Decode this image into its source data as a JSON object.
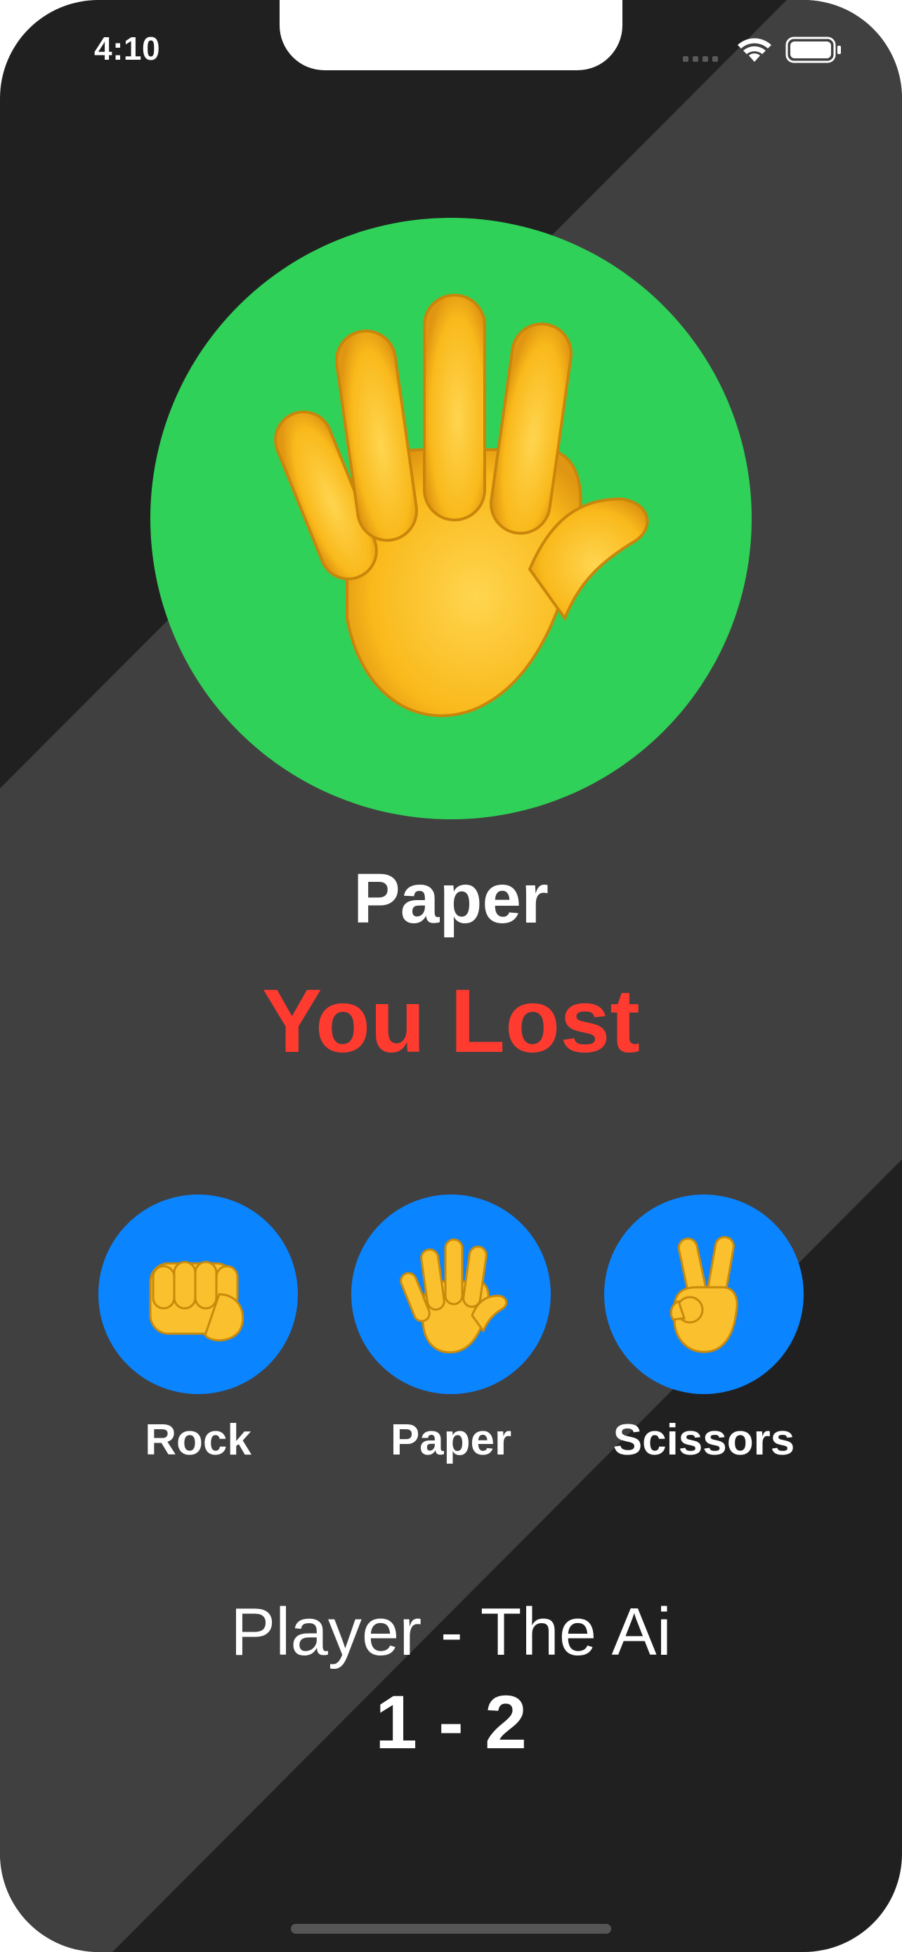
{
  "status_bar": {
    "time": "4:10"
  },
  "result": {
    "ai_choice_label": "Paper",
    "ai_choice_icon": "raised-hand-icon",
    "outcome": "You Lost",
    "outcome_color": "#ff3b30",
    "circle_color": "#30d158"
  },
  "choices": [
    {
      "label": "Rock",
      "icon": "oncoming-fist-icon"
    },
    {
      "label": "Paper",
      "icon": "raised-hand-icon"
    },
    {
      "label": "Scissors",
      "icon": "victory-hand-icon"
    }
  ],
  "choice_button_color": "#0a84ff",
  "score": {
    "title": "Player - The Ai",
    "value": "1 - 2"
  }
}
